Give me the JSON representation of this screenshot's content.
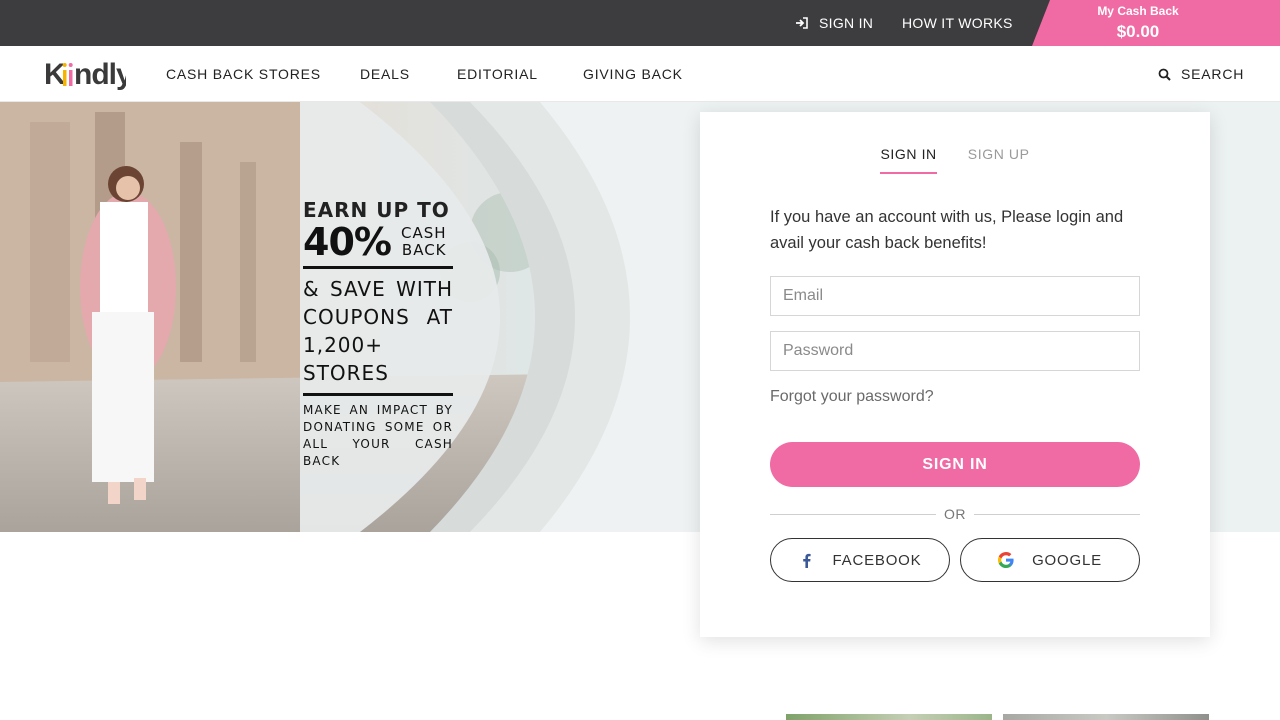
{
  "topbar": {
    "sign_in": "SIGN IN",
    "how_it_works": "HOW IT WORKS",
    "cash_back_label": "My Cash Back",
    "cash_back_amount": "$0.00",
    "accent_color": "#f06aa4",
    "bg_color": "#3d3d3f"
  },
  "nav": {
    "logo": "Kiindly",
    "items": [
      "CASH BACK STORES",
      "DEALS",
      "EDITORIAL",
      "GIVING BACK"
    ],
    "search": "SEARCH",
    "search_icon": "search-icon"
  },
  "hero": {
    "line1": "EARN UP TO",
    "big": "40%",
    "small1": "CASH",
    "small2": "BACK",
    "mid1": "& SAVE WITH",
    "mid2": "COUPONS AT",
    "mid3": "1,200+ STORES",
    "foot1": "MAKE AN IMPACT BY",
    "foot2": "DONATING SOME OR",
    "foot3": "ALL YOUR CASH BACK"
  },
  "auth": {
    "tab_signin": "SIGN IN",
    "tab_signup": "SIGN UP",
    "intro": "If you have an account with us, Please login and avail your cash back benefits!",
    "email_placeholder": "Email",
    "password_placeholder": "Password",
    "forgot": "Forgot your password?",
    "submit": "SIGN IN",
    "or": "OR",
    "facebook": "FACEBOOK",
    "google": "GOOGLE"
  }
}
